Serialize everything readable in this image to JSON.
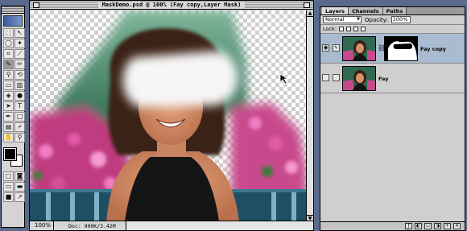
{
  "document": {
    "title": "MaskDemo.psd @ 100% (Fay copy,Layer Mask)",
    "zoom": "100%",
    "doc_info": "Doc: 900K/3.42M"
  },
  "toolbox": {
    "tools": [
      {
        "icon": "marquee-icon",
        "glyph": "⬚"
      },
      {
        "icon": "move-icon",
        "glyph": "↖"
      },
      {
        "icon": "lasso-icon",
        "glyph": "◯"
      },
      {
        "icon": "magic-wand-icon",
        "glyph": "✦"
      },
      {
        "icon": "crop-icon",
        "glyph": "⌗"
      },
      {
        "icon": "slice-icon",
        "glyph": "⟋"
      },
      {
        "icon": "brush-icon",
        "glyph": "✎"
      },
      {
        "icon": "pencil-icon",
        "glyph": "✏"
      },
      {
        "icon": "stamp-icon",
        "glyph": "⚲"
      },
      {
        "icon": "history-brush-icon",
        "glyph": "⟲"
      },
      {
        "icon": "eraser-icon",
        "glyph": "▭"
      },
      {
        "icon": "gradient-icon",
        "glyph": "▥"
      },
      {
        "icon": "blur-icon",
        "glyph": "◈"
      },
      {
        "icon": "dodge-icon",
        "glyph": "●"
      },
      {
        "icon": "path-select-icon",
        "glyph": "➤"
      },
      {
        "icon": "type-icon",
        "glyph": "T"
      },
      {
        "icon": "pen-icon",
        "glyph": "✒"
      },
      {
        "icon": "shape-icon",
        "glyph": "□"
      },
      {
        "icon": "notes-icon",
        "glyph": "▤"
      },
      {
        "icon": "eyedropper-icon",
        "glyph": "⌿"
      },
      {
        "icon": "hand-icon",
        "glyph": "✋"
      },
      {
        "icon": "zoom-icon",
        "glyph": "⚲"
      }
    ],
    "active_tool_index": 6,
    "mode_icons": [
      {
        "icon": "standard-mode-icon",
        "glyph": "▢"
      },
      {
        "icon": "quickmask-mode-icon",
        "glyph": "◙"
      },
      {
        "icon": "screen-mode-standard-icon",
        "glyph": "▭"
      },
      {
        "icon": "screen-mode-full-icon",
        "glyph": "▬"
      },
      {
        "icon": "screen-mode-black-icon",
        "glyph": "■"
      },
      {
        "icon": "jump-to-imageready-icon",
        "glyph": "↗"
      }
    ]
  },
  "layers_palette": {
    "tabs": [
      "Layers",
      "Channels",
      "Paths"
    ],
    "active_tab": "Layers",
    "blend_mode": "Normal",
    "opacity_label": "Opacity:",
    "opacity_value": "100%",
    "lock_label": "Lock:",
    "layers": [
      {
        "name": "Fay copy",
        "visible": true,
        "selected": true,
        "has_mask": true
      },
      {
        "name": "Fay",
        "visible": false,
        "selected": false,
        "has_mask": false
      }
    ],
    "footer_icons": [
      "layer-style-icon",
      "mask-icon",
      "new-set-icon",
      "adjustment-layer-icon",
      "new-layer-icon",
      "trash-icon"
    ]
  },
  "colors": {
    "selection": "#a9bbd0",
    "desktop": "#5a6a8c"
  }
}
